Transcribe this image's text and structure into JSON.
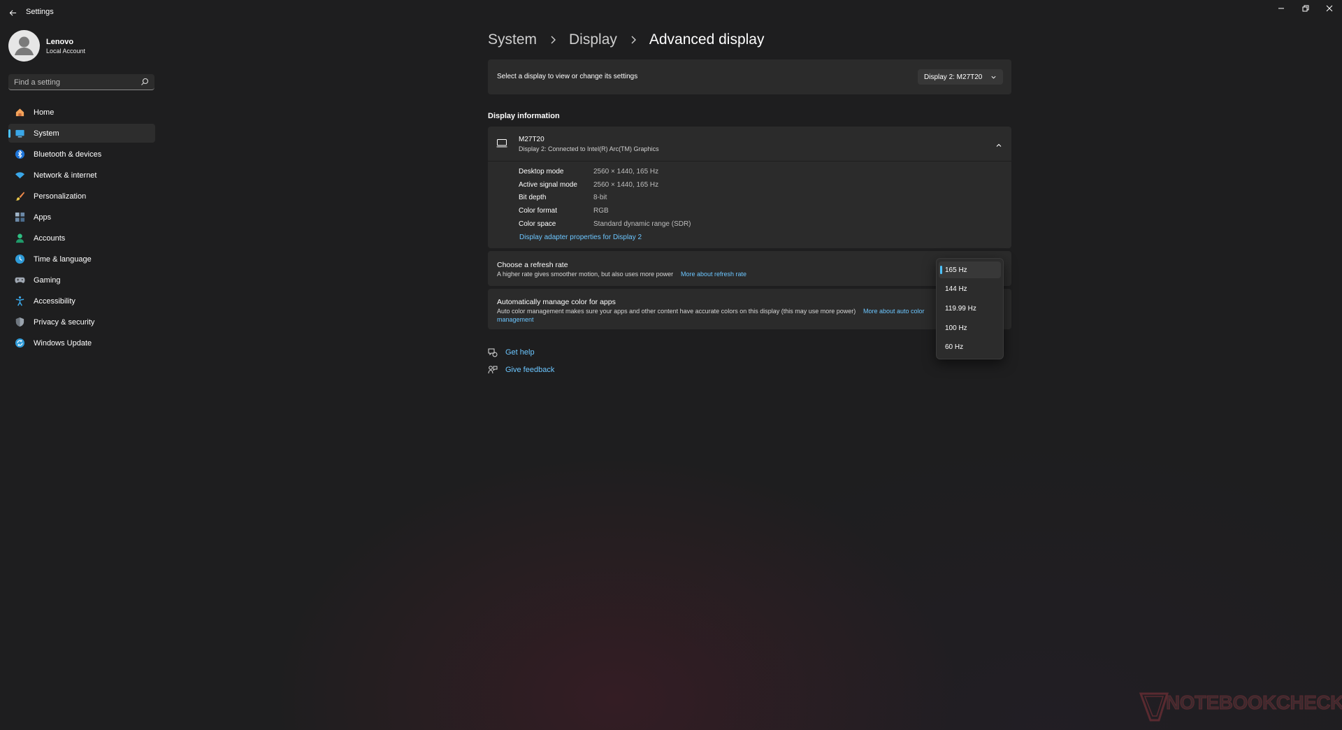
{
  "window": {
    "title": "Settings"
  },
  "profile": {
    "name": "Lenovo",
    "account_type": "Local Account"
  },
  "search": {
    "placeholder": "Find a setting"
  },
  "sidebar": {
    "items": [
      {
        "label": "Home",
        "icon": "home-icon",
        "active": false
      },
      {
        "label": "System",
        "icon": "system-icon",
        "active": true
      },
      {
        "label": "Bluetooth & devices",
        "icon": "bluetooth-icon",
        "active": false
      },
      {
        "label": "Network & internet",
        "icon": "wifi-icon",
        "active": false
      },
      {
        "label": "Personalization",
        "icon": "brush-icon",
        "active": false
      },
      {
        "label": "Apps",
        "icon": "apps-icon",
        "active": false
      },
      {
        "label": "Accounts",
        "icon": "accounts-icon",
        "active": false
      },
      {
        "label": "Time & language",
        "icon": "time-language-icon",
        "active": false
      },
      {
        "label": "Gaming",
        "icon": "gaming-icon",
        "active": false
      },
      {
        "label": "Accessibility",
        "icon": "accessibility-icon",
        "active": false
      },
      {
        "label": "Privacy & security",
        "icon": "shield-icon",
        "active": false
      },
      {
        "label": "Windows Update",
        "icon": "update-icon",
        "active": false
      }
    ]
  },
  "breadcrumb": {
    "items": [
      "System",
      "Display",
      "Advanced display"
    ]
  },
  "display_select": {
    "label": "Select a display to view or change its settings",
    "value": "Display 2: M27T20"
  },
  "display_info": {
    "section_title": "Display information",
    "monitor_name": "M27T20",
    "monitor_sub": "Display 2: Connected to Intel(R) Arc(TM) Graphics",
    "rows": [
      {
        "key": "Desktop mode",
        "value": "2560 × 1440, 165 Hz"
      },
      {
        "key": "Active signal mode",
        "value": "2560 × 1440, 165 Hz"
      },
      {
        "key": "Bit depth",
        "value": "8-bit"
      },
      {
        "key": "Color format",
        "value": "RGB"
      },
      {
        "key": "Color space",
        "value": "Standard dynamic range (SDR)"
      }
    ],
    "adapter_link": "Display adapter properties for Display 2"
  },
  "refresh_rate": {
    "title": "Choose a refresh rate",
    "description": "A higher rate gives smoother motion, but also uses more power",
    "link": "More about refresh rate",
    "options": [
      "165 Hz",
      "144 Hz",
      "119.99 Hz",
      "100 Hz",
      "60 Hz"
    ],
    "selected": "165 Hz"
  },
  "color_management": {
    "title": "Automatically manage color for apps",
    "description": "Auto color management makes sure your apps and other content have accurate colors on this display (this may use more power)",
    "link_part1": "More about auto color",
    "link_part2": "management"
  },
  "help": {
    "get_help": "Get help",
    "give_feedback": "Give feedback"
  },
  "watermark": {
    "text": "NOTEBOOKCHECK"
  },
  "colors": {
    "accent": "#4cc2ff",
    "link": "#6cc6ff",
    "background": "#1e1e1f",
    "card": "#2b2b2b"
  }
}
